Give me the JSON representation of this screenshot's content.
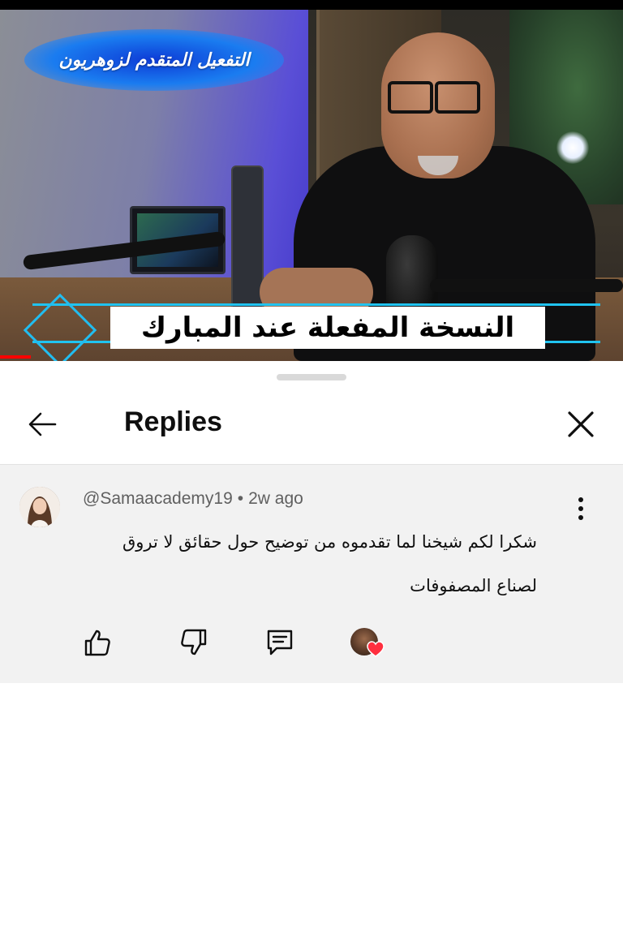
{
  "video": {
    "overlay_title": "التفعيل المتقدم لزوهريون",
    "caption": "النسخة المفعلة عند المبارك"
  },
  "sheet": {
    "title": "Replies",
    "icons": {
      "back": "arrow-left-icon",
      "close": "close-icon"
    }
  },
  "comment": {
    "author": "@Samaacademy19",
    "separator": "•",
    "time": "2w ago",
    "text": "شكرا لكم شيخنا لما تقدموه من توضيح حول حقائق لا تروق لصناع المصفوفات",
    "actions": {
      "like": "thumbs-up-icon",
      "dislike": "thumbs-down-icon",
      "reply": "reply-icon",
      "creator_heart": "creator-heart-icon",
      "more": "more-vertical-icon"
    }
  },
  "colors": {
    "accent_red": "#ff0000",
    "heart_red": "#ff2f3f",
    "comment_bg": "#f2f2f2",
    "meta_gray": "#606060"
  }
}
